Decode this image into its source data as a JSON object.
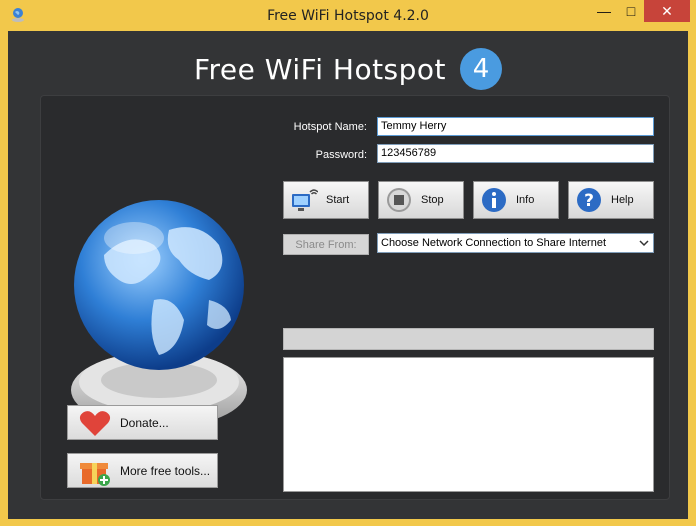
{
  "window": {
    "title": "Free WiFi Hotspot 4.2.0",
    "controls": {
      "minimize": "—",
      "maximize": "□",
      "close": "✕"
    }
  },
  "logo": {
    "text": "Free WiFi Hotspot",
    "badge": "4"
  },
  "form": {
    "hotspot_name_label": "Hotspot Name:",
    "hotspot_name_value": "Temmy Herry",
    "password_label": "Password:",
    "password_value": "123456789"
  },
  "actions": {
    "start": "Start",
    "stop": "Stop",
    "info": "Info",
    "help": "Help"
  },
  "share": {
    "button_label": "Share From:",
    "selected": "Choose Network Connection to Share Internet"
  },
  "side": {
    "donate": "Donate...",
    "more_tools": "More free tools..."
  },
  "icons": [
    "app-globe-icon",
    "monitor-wifi-icon",
    "stop-icon",
    "info-icon",
    "help-icon",
    "heart-icon",
    "gift-icon",
    "globe-icon",
    "dropdown-caret-icon"
  ],
  "colors": {
    "accent": "#4a9be0",
    "background": "#333436",
    "close": "#c7443a"
  }
}
